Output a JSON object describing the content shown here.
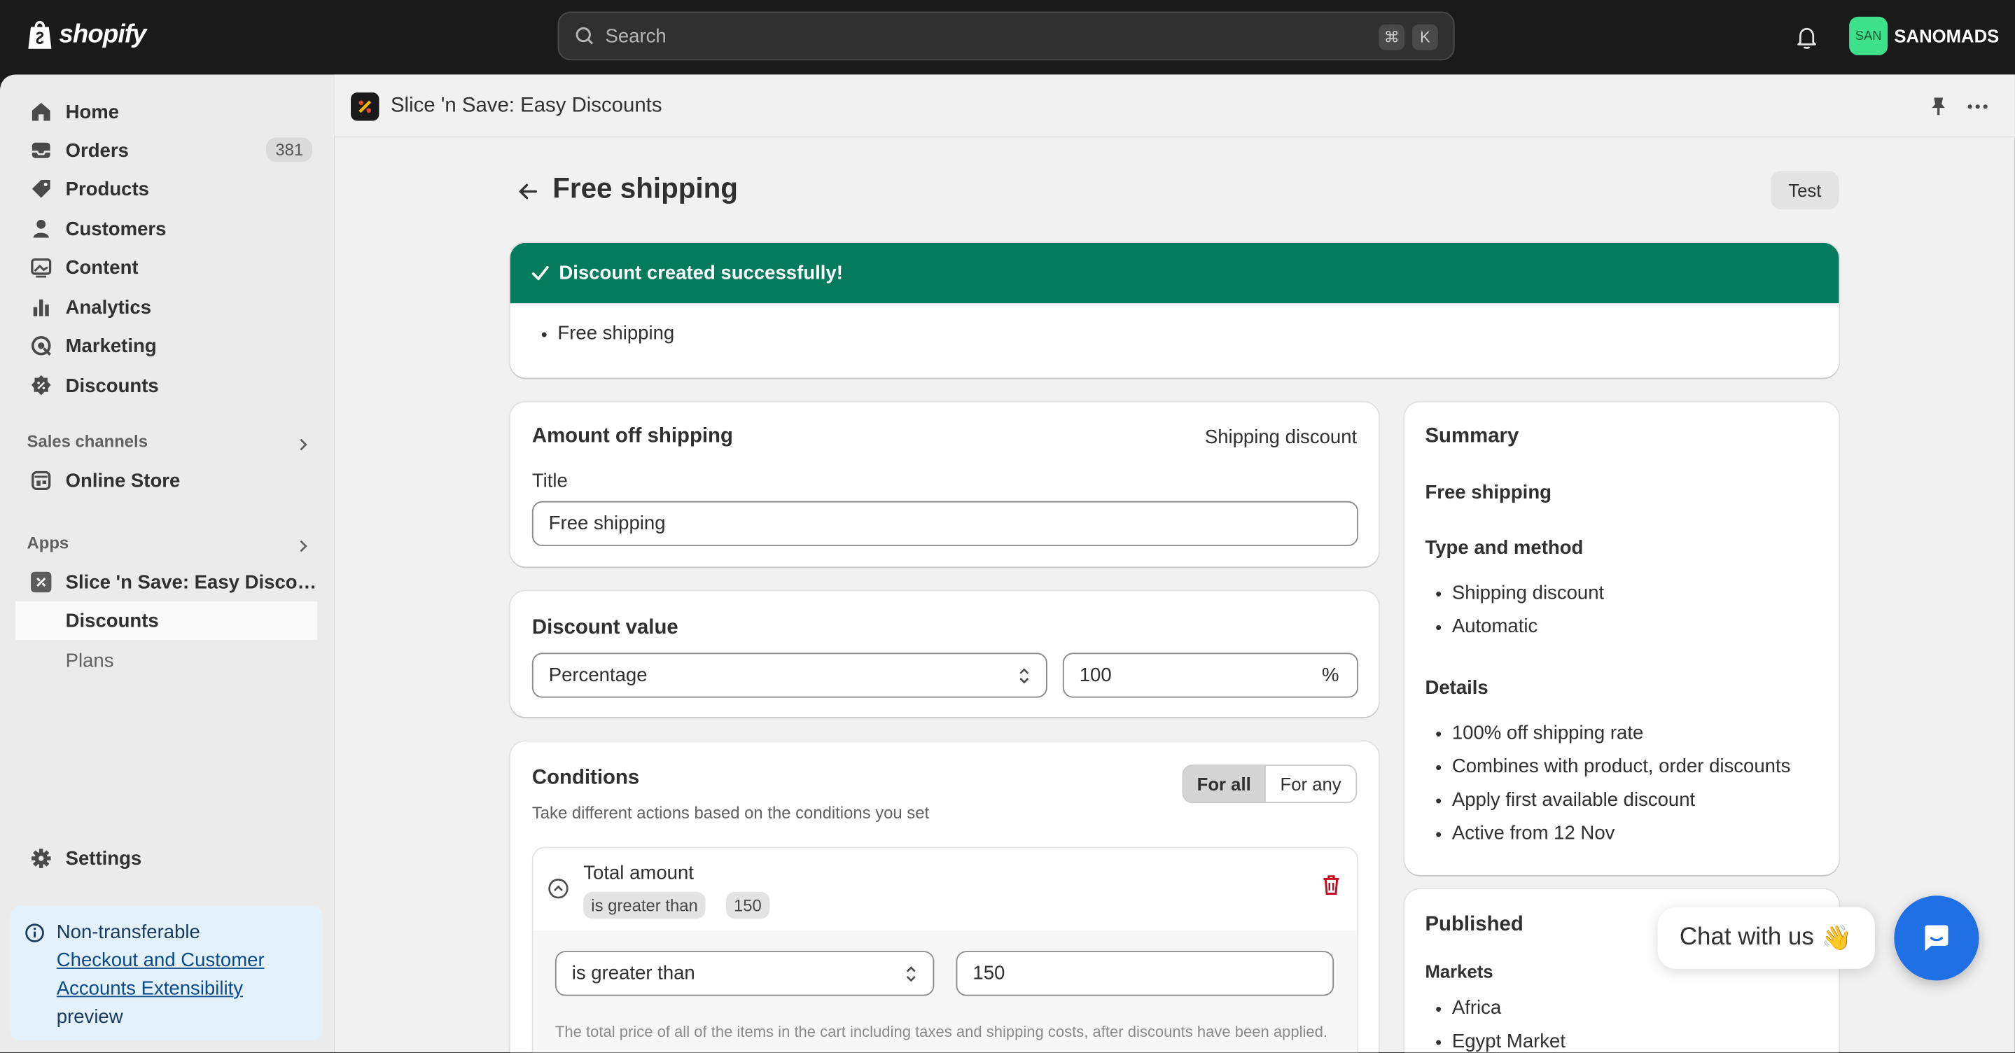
{
  "topbar": {
    "logo_text": "shopify",
    "search_placeholder": "Search",
    "shortcut_cmd": "⌘",
    "shortcut_key": "K",
    "avatar_initials": "SAN",
    "store_name": "SANOMADS"
  },
  "sidebar": {
    "items": [
      {
        "label": "Home",
        "icon": "home-icon"
      },
      {
        "label": "Orders",
        "icon": "inbox-icon",
        "badge": "381"
      },
      {
        "label": "Products",
        "icon": "tag-icon"
      },
      {
        "label": "Customers",
        "icon": "person-icon"
      },
      {
        "label": "Content",
        "icon": "image-icon"
      },
      {
        "label": "Analytics",
        "icon": "bar-chart-icon"
      },
      {
        "label": "Marketing",
        "icon": "target-icon"
      },
      {
        "label": "Discounts",
        "icon": "discount-icon"
      }
    ],
    "sales_channels_label": "Sales channels",
    "online_store_label": "Online Store",
    "apps_label": "Apps",
    "app_item_label": "Slice 'n Save: Easy Discou...",
    "app_sub_discounts": "Discounts",
    "app_sub_plans": "Plans",
    "settings_label": "Settings",
    "callout": {
      "line1": "Non-transferable",
      "link": "Checkout and Customer Accounts Extensibility",
      "line3": "preview"
    }
  },
  "app_header": {
    "title": "Slice 'n Save: Easy Discounts"
  },
  "page": {
    "title": "Free shipping",
    "test_button": "Test"
  },
  "banner": {
    "title": "Discount created successfully!",
    "item": "Free shipping",
    "color": "#047b5d"
  },
  "amount_card": {
    "title": "Amount off shipping",
    "type_label": "Shipping discount",
    "field_label": "Title",
    "field_value": "Free shipping"
  },
  "value_card": {
    "title": "Discount value",
    "select_value": "Percentage",
    "amount_value": "100",
    "suffix": "%"
  },
  "conditions_card": {
    "title": "Conditions",
    "description": "Take different actions based on the conditions you set",
    "toggle_all": "For all",
    "toggle_any": "For any",
    "condition": {
      "name": "Total amount",
      "tag_operator": "is greater than",
      "tag_value": "150",
      "operator_value": "is greater than",
      "value": "150",
      "help": "The total price of all of the items in the cart including taxes and shipping costs, after discounts have been applied."
    }
  },
  "summary": {
    "title": "Summary",
    "name": "Free shipping",
    "type_heading": "Type and method",
    "type_items": [
      "Shipping discount",
      "Automatic"
    ],
    "details_heading": "Details",
    "details_items": [
      "100% off shipping rate",
      "Combines with product, order discounts",
      "Apply first available discount",
      "Active from 12 Nov"
    ]
  },
  "published": {
    "title": "Published",
    "markets_heading": "Markets",
    "markets": [
      "Africa",
      "Egypt Market"
    ]
  },
  "chat": {
    "label": "Chat with us",
    "emoji": "👋",
    "accent": "#1f6fe5"
  }
}
